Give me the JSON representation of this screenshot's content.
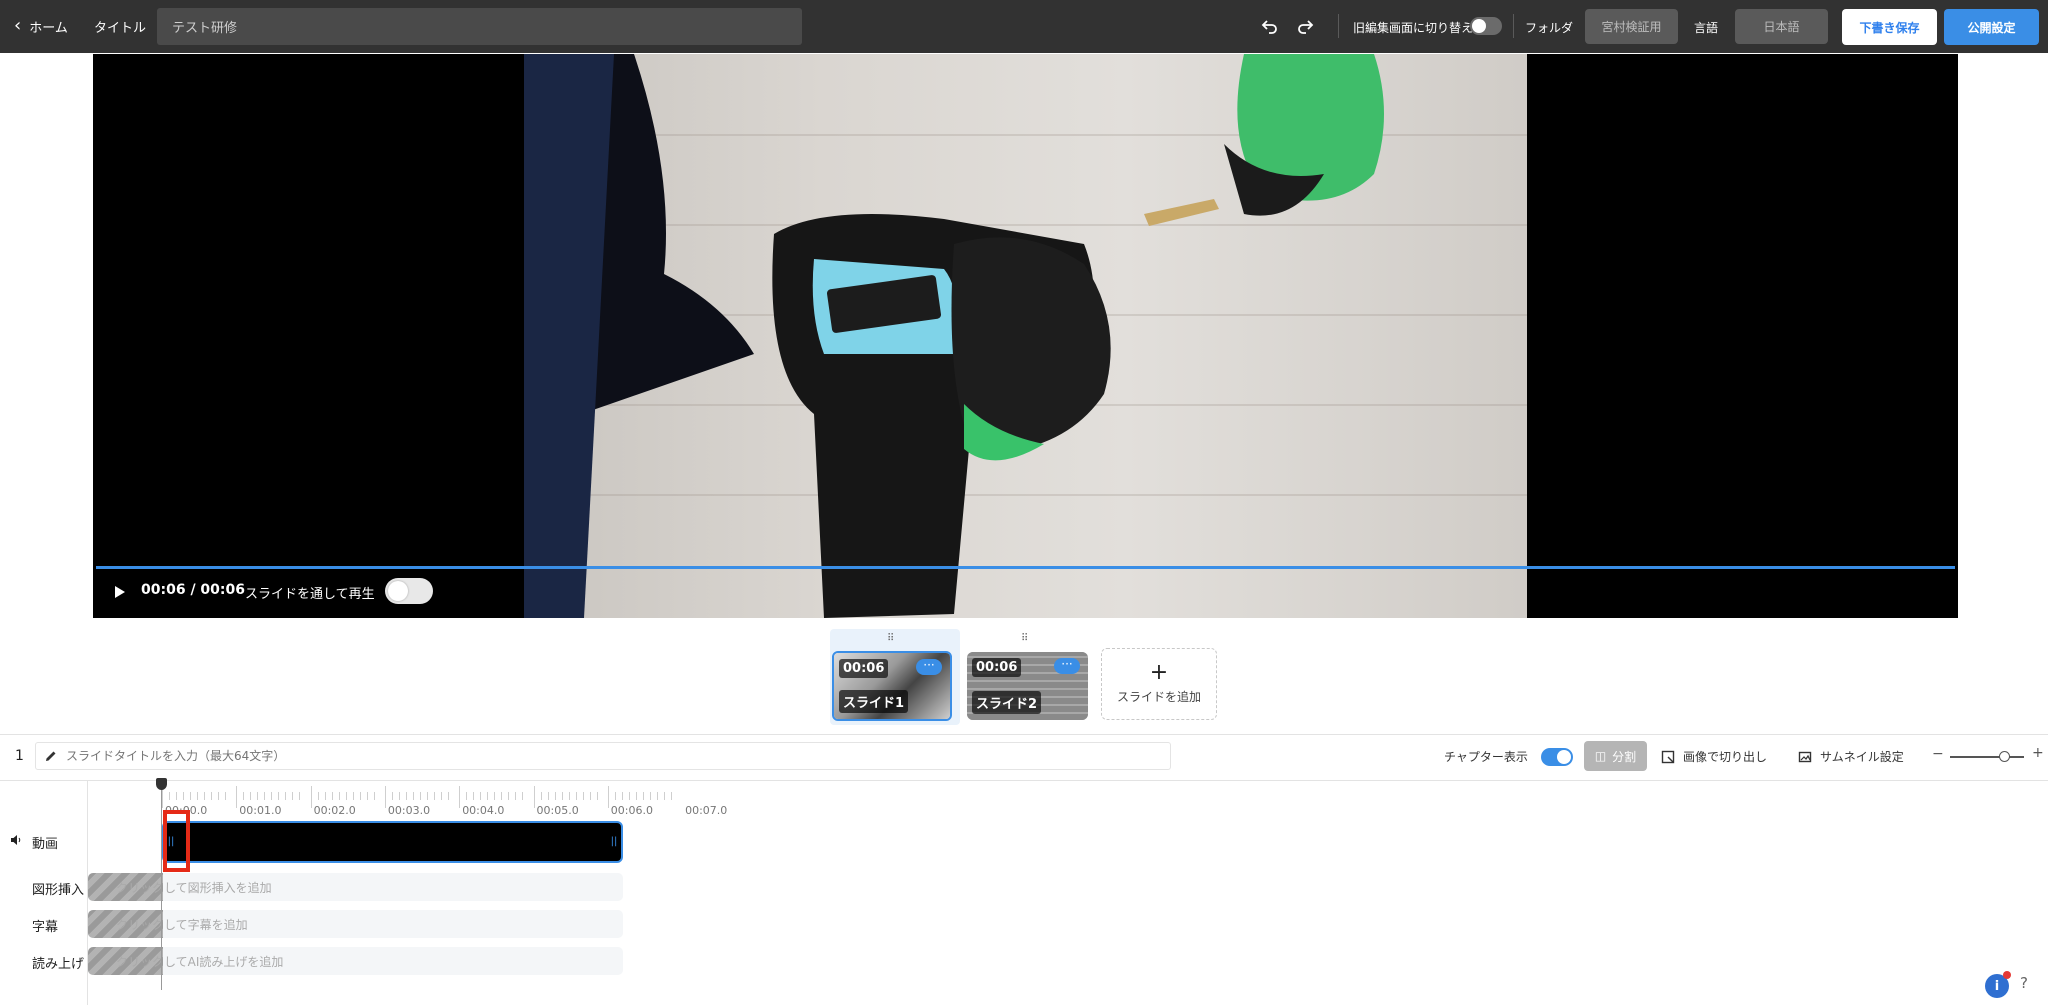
{
  "topbar": {
    "back_label": "ホーム",
    "title_label": "タイトル",
    "title_value": "テスト研修",
    "old_editor_label": "旧編集画面に切り替え",
    "folder_label": "フォルダ",
    "folder_value": "宮村検証用",
    "language_label": "言語",
    "language_value": "日本語",
    "save_draft_label": "下書き保存",
    "publish_label": "公開設定"
  },
  "player": {
    "time": "00:06 / 00:06",
    "play_through_label": "スライドを通して再生",
    "progress": 1.0
  },
  "slides": [
    {
      "duration": "00:06",
      "name": "スライド1",
      "active": true
    },
    {
      "duration": "00:06",
      "name": "スライド2",
      "active": false
    }
  ],
  "add_slide_label": "スライドを追加",
  "slide_toolbar": {
    "slide_number": "1",
    "title_placeholder": "スライドタイトルを入力（最大64文字）",
    "chapter_label": "チャプター表示",
    "split_label": "分割",
    "crop_image_label": "画像で切り出し",
    "thumbnail_label": "サムネイル設定",
    "zoom_minus": "−",
    "zoom_plus": "+"
  },
  "timeline": {
    "ruler": [
      "00:00.0",
      "00:01.0",
      "00:02.0",
      "00:03.0",
      "00:04.0",
      "00:05.0",
      "00:06.0",
      "00:07.0"
    ],
    "tracks": {
      "video": "動画",
      "shape": "図形挿入",
      "subtitle": "字幕",
      "narration": "読み上げ"
    },
    "add_shape": "クリックして図形挿入を追加",
    "add_subtitle": "クリックして字幕を追加",
    "add_narration": "クリックしてAI読み上げを追加"
  },
  "help": {
    "info": "i",
    "question": "?"
  },
  "colors": {
    "accent": "#3a8ee6",
    "topbar": "#323232",
    "highlight": "#e52a17"
  }
}
